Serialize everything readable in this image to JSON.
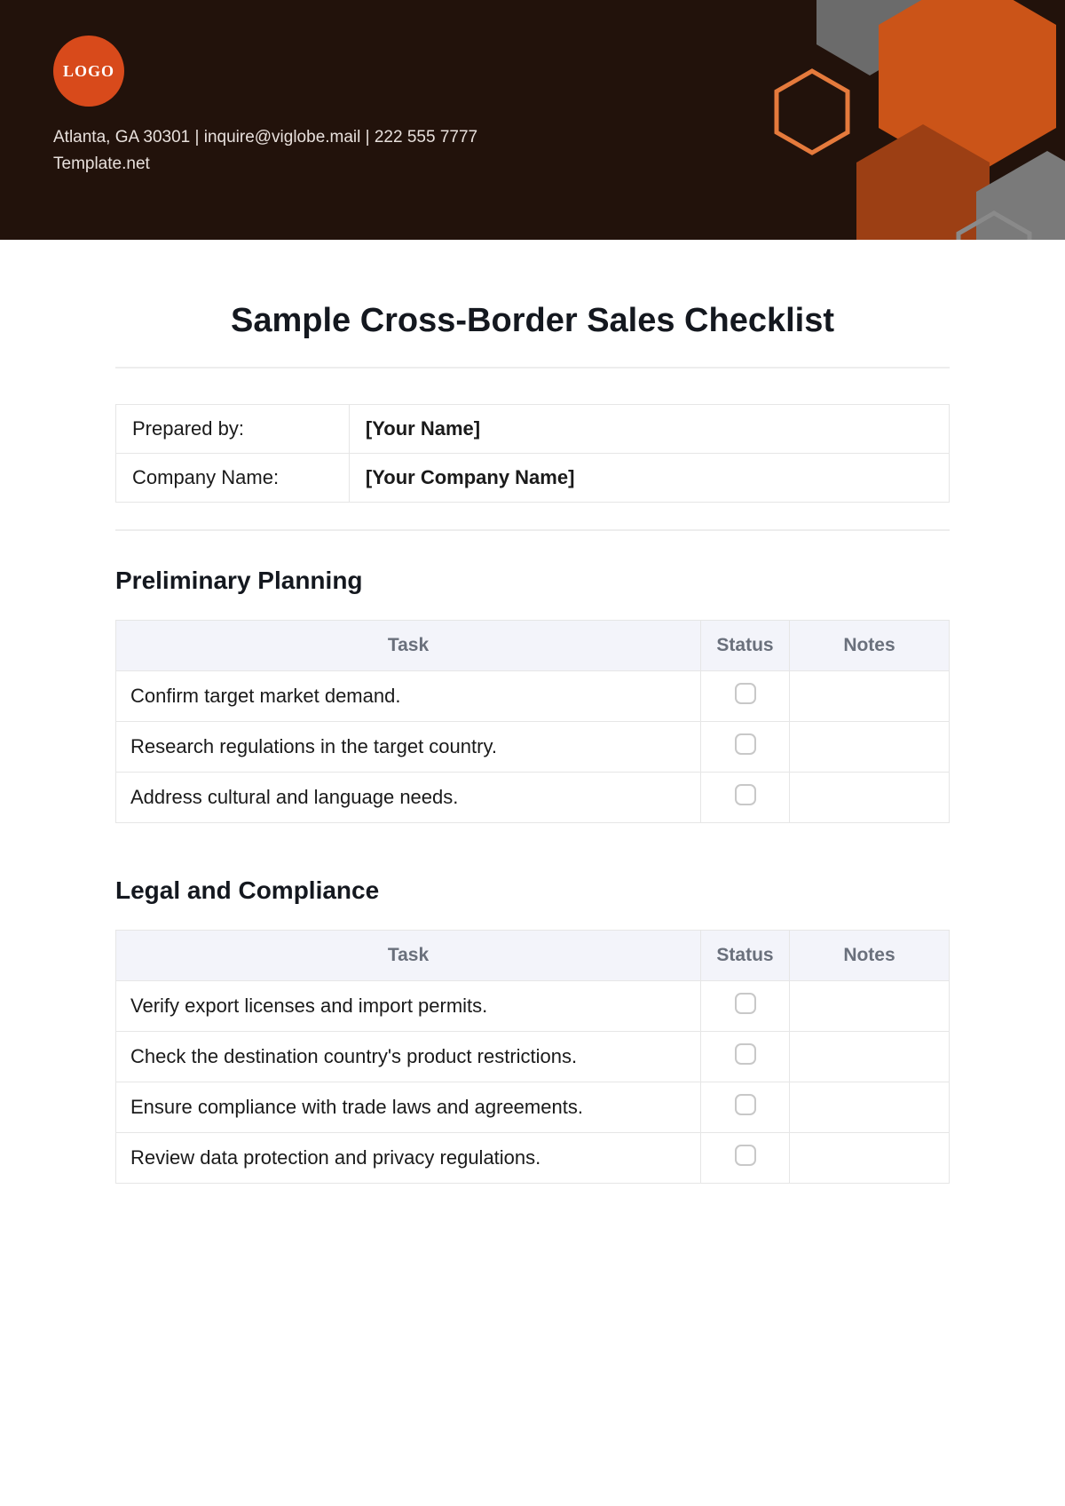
{
  "header": {
    "logo_text": "LOGO",
    "contact_line1": "Atlanta, GA 30301 | inquire@viglobe.mail  |  222 555 7777",
    "contact_line2": "Template.net"
  },
  "title": "Sample Cross-Border Sales Checklist",
  "info": {
    "prepared_label": "Prepared by:",
    "prepared_value": "[Your Name]",
    "company_label": "Company Name:",
    "company_value": "[Your Company Name]"
  },
  "columns": {
    "task": "Task",
    "status": "Status",
    "notes": "Notes"
  },
  "sections": [
    {
      "heading": "Preliminary Planning",
      "tasks": [
        "Confirm target market demand.",
        "Research regulations in the target country.",
        "Address cultural and language needs."
      ]
    },
    {
      "heading": "Legal and Compliance",
      "tasks": [
        "Verify export licenses and import permits.",
        "Check the destination country's product restrictions.",
        "Ensure compliance with trade laws and agreements.",
        "Review data protection and privacy regulations."
      ]
    }
  ]
}
